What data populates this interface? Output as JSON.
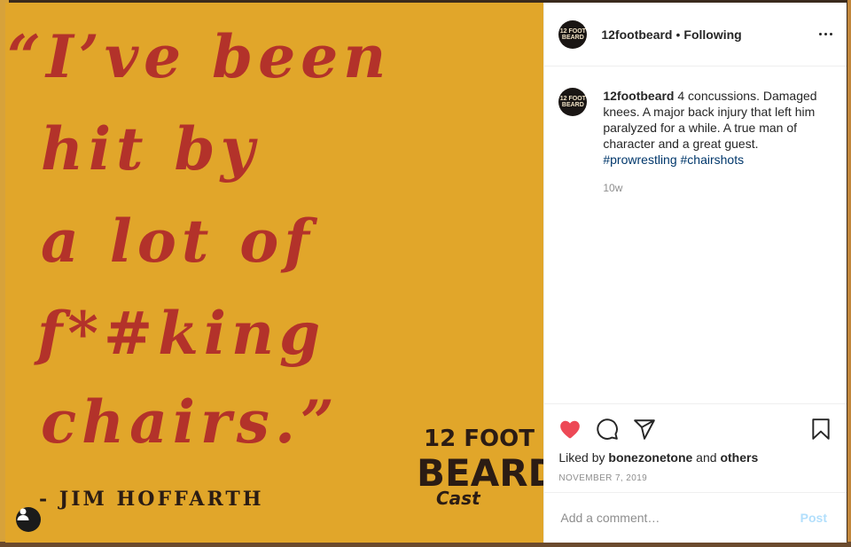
{
  "post": {
    "image_quote_lines": [
      "“I’ve been",
      "hit by",
      "a lot of",
      "f*#king",
      "chairs.”"
    ],
    "image_author": "- JIM HOFFARTH",
    "image_logo": {
      "line1": "12 FOOT",
      "line2": "BEARD",
      "line3": "Cast"
    }
  },
  "header": {
    "avatar_text": "12 FOOT BEARD",
    "username": "12footbeard",
    "separator": "•",
    "follow_status": "Following"
  },
  "caption": {
    "username": "12footbeard",
    "text": " 4 concussions. Damaged knees. A major back injury that left him paralyzed for a while. A true man of character and a great guest. ",
    "hashtags": [
      "#prowrestling",
      "#chairshots"
    ],
    "time": "10w"
  },
  "engagement": {
    "liked_prefix": "Liked by ",
    "liked_user": "bonezonetone",
    "liked_and": " and ",
    "liked_others": "others",
    "date": "NOVEMBER 7, 2019",
    "liked": true
  },
  "comment": {
    "placeholder": "Add a comment…",
    "post_label": "Post"
  },
  "colors": {
    "poster_bg": "#e1a62a",
    "quote": "#b3322a",
    "like_heart": "#ed4956",
    "hashtag": "#00376b"
  }
}
